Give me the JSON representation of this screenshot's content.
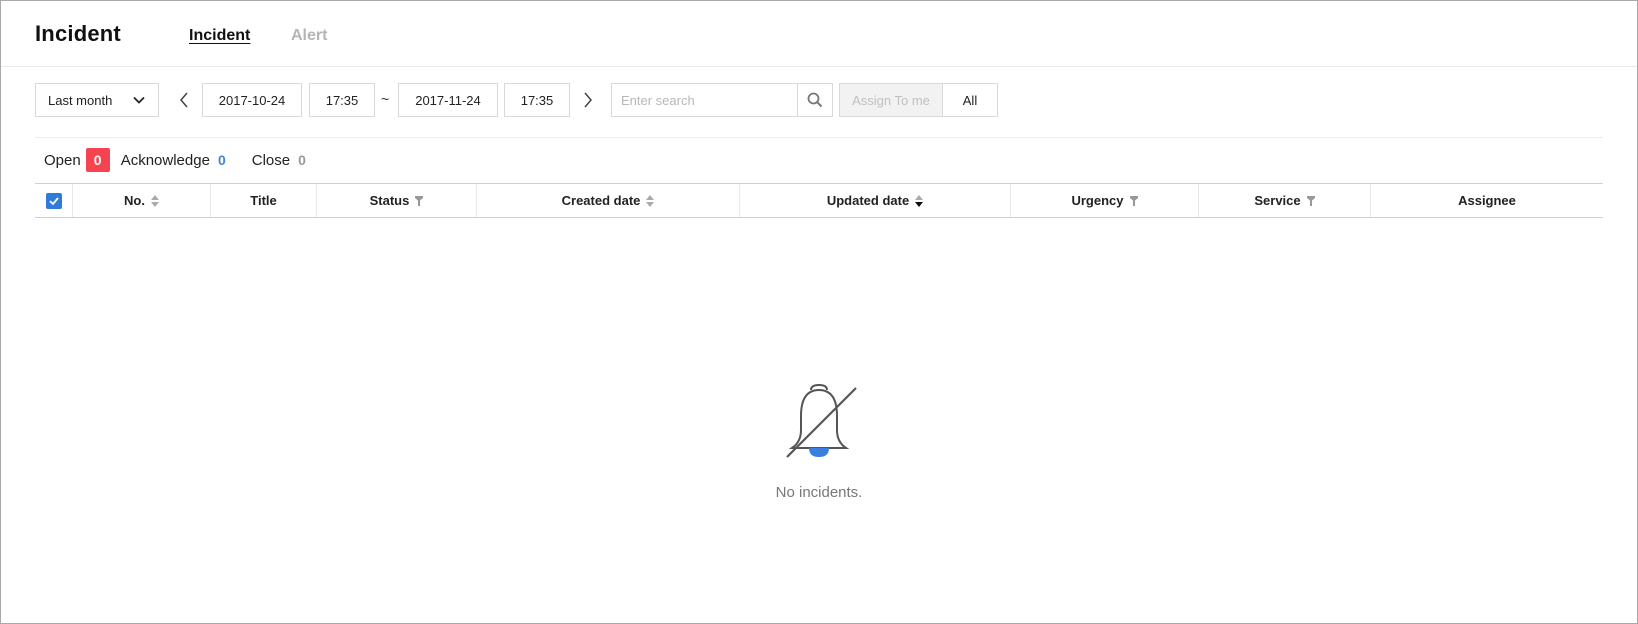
{
  "header": {
    "title": "Incident",
    "tabs": [
      {
        "label": "Incident",
        "active": true
      },
      {
        "label": "Alert",
        "active": false
      }
    ]
  },
  "toolbar": {
    "period": "Last month",
    "start_date": "2017-10-24",
    "start_time": "17:35",
    "separator": "~",
    "end_date": "2017-11-24",
    "end_time": "17:35",
    "search_placeholder": "Enter search",
    "assign_to_me": "Assign To me",
    "all": "All"
  },
  "counts": {
    "open_label": "Open",
    "open_count": "0",
    "ack_label": "Acknowledge",
    "ack_count": "0",
    "close_label": "Close",
    "close_count": "0"
  },
  "table": {
    "columns": [
      "No.",
      "Title",
      "Status",
      "Created date",
      "Updated date",
      "Urgency",
      "Service",
      "Assignee"
    ]
  },
  "empty_state": {
    "message": "No incidents.",
    "icon": "bell-off-icon"
  },
  "colors": {
    "open_badge": "#f5434f",
    "ack_count": "#3d86d6",
    "close_count": "#999999",
    "checkbox": "#2e7bdb",
    "bell_accent": "#3a7fe0"
  }
}
